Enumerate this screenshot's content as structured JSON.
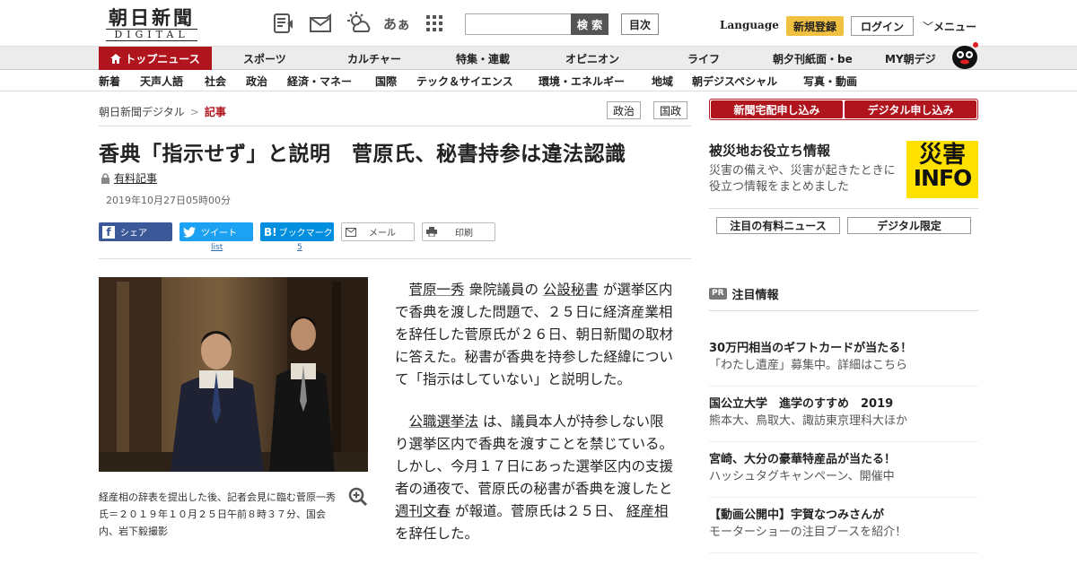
{
  "header": {
    "logo_jp": "朝日新聞",
    "logo_en": "DIGITAL",
    "icons": [
      "digital-paper-icon",
      "newsletter-icon",
      "weather-icon",
      "font-size-icon",
      "grid-menu-icon"
    ],
    "font_size_label": "あぁ",
    "search_placeholder": "",
    "search_button": "検 索",
    "contents_button": "目次",
    "language": "Language",
    "register": "新規登録",
    "login": "ログイン",
    "menu": "メニュー"
  },
  "nav_main": [
    "トップニュース",
    "スポーツ",
    "カルチャー",
    "特集・連載",
    "オピニオン",
    "ライフ",
    "朝夕刊紙面・be",
    "MY朝デジ"
  ],
  "nav_sub": [
    "新着",
    "天声人語",
    "社会",
    "政治",
    "経済・マネー",
    "国際",
    "テック＆サイエンス",
    "環境・エネルギー",
    "地域",
    "朝デジスペシャル",
    "写真・動画"
  ],
  "breadcrumb": {
    "home": "朝日新聞デジタル",
    "sep": ">",
    "current": "記事"
  },
  "tags": [
    "政治",
    "国政"
  ],
  "article": {
    "title": "香典「指示せず」と説明　菅原氏、秘書持参は違法認識",
    "paid_label": "有料記事",
    "date": "2019年10月27日05時00分",
    "share": {
      "facebook": "シェア",
      "twitter": "ツイート",
      "twitter_count": "list",
      "hatena": "ブックマーク",
      "hatena_count": "5",
      "mail": "メール",
      "print": "印刷"
    },
    "caption": "経産相の辞表を提出した後、記者会見に臨む菅原一秀氏＝２０１９年１０月２５日午前８時３７分、国会内、岩下毅撮影",
    "p1": {
      "link1": "菅原一秀",
      "t1": "衆院議員の",
      "link2": "公設秘書",
      "t2": "が選挙区内で香典を渡した問題で、２５日に経済産業相を辞任した菅原氏が２６日、朝日新聞の取材に答えた。秘書が香典を持参した経緯について「指示はしていない」と説明した。"
    },
    "p2": {
      "link1": "公職選挙法",
      "t1": "は、議員本人が持参しない限り選挙区内で香典を渡すことを禁じている。しかし、今月１７日にあった選挙区内の支援者の通夜で、菅原氏の秘書が香典を渡したと",
      "link2": "週刊文春",
      "t2": "が報道。菅原氏は２５日、",
      "link3": "経産相",
      "t3": "を辞任した。"
    }
  },
  "sidebar": {
    "btn_delivery": "新聞宅配申し込み",
    "btn_digital": "デジタル申し込み",
    "disaster_title": "被災地お役立ち情報",
    "disaster_desc": "災害の備えや、災害が起きたときに役立つ情報をまとめました",
    "disaster_logo_a": "災害",
    "disaster_logo_b": "INFO",
    "tab1": "注目の有料ニュース",
    "tab2": "デジタル限定",
    "pr_tag": "PR",
    "pr_title": "注目情報",
    "ads": [
      {
        "h": "30万円相当のギフトカードが当たる！",
        "s": "「わたし遺産」募集中。詳細はこちら"
      },
      {
        "h": "国公立大学　進学のすすめ　2019",
        "s": "熊本大、鳥取大、諏訪東京理科大ほか"
      },
      {
        "h": "宮崎、大分の豪華特産品が当たる！",
        "s": "ハッシュタグキャンペーン、開催中"
      },
      {
        "h": "【動画公開中】宇賀なつみさんが",
        "s": "モーターショーの注目ブースを紹介！"
      }
    ]
  },
  "colors": {
    "brand_red": "#b0141d",
    "register_yellow": "#f0c040",
    "facebook": "#3b5998",
    "twitter": "#1da1f2",
    "hatena": "#008fde",
    "disaster_yellow": "#ffe100"
  }
}
